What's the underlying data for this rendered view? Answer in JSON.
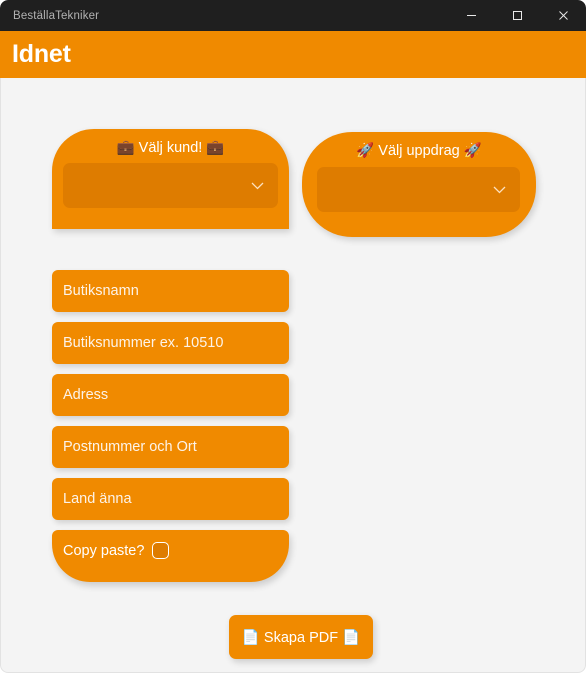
{
  "window": {
    "title": "BeställaTekniker",
    "controls": {
      "minimize": "minimize-button",
      "maximize": "maximize-button",
      "close": "close-button"
    }
  },
  "header": {
    "title": "Idnet",
    "background_color": "#F08A00"
  },
  "pickers": [
    {
      "id": "customer",
      "label": "💼 Välj kund! 💼",
      "label_text": "Välj kund!",
      "icon": "briefcase-emoji",
      "dropdown_value": "",
      "dropdown_icon": "chevron-down-icon"
    },
    {
      "id": "mission",
      "label": "🚀 Välj uppdrag 🚀",
      "label_text": "Välj uppdrag",
      "icon": "rocket-emoji",
      "dropdown_value": "",
      "dropdown_icon": "chevron-down-icon"
    }
  ],
  "fields": [
    {
      "name": "butiksnamn",
      "placeholder": "Butiksnamn",
      "value": ""
    },
    {
      "name": "butiksnummer",
      "placeholder": "Butiksnummer ex. 10510",
      "value": ""
    },
    {
      "name": "adress",
      "placeholder": "Adress",
      "value": ""
    },
    {
      "name": "postnummer",
      "placeholder": "Postnummer och Ort",
      "value": ""
    },
    {
      "name": "land",
      "placeholder": "Land änna",
      "value": ""
    }
  ],
  "copy_paste": {
    "label": "Copy paste?",
    "checked": false
  },
  "actions": {
    "pdf_button": "📄 Skapa PDF 📄",
    "pdf_button_text": "Skapa PDF",
    "pdf_icon": "document-emoji"
  },
  "colors": {
    "accent": "#F08A00",
    "accent_dark": "#DE7C00",
    "titlebar": "#1F1F1F",
    "page_background": "#F4F4F4",
    "text_on_accent": "#FFFFFF"
  }
}
